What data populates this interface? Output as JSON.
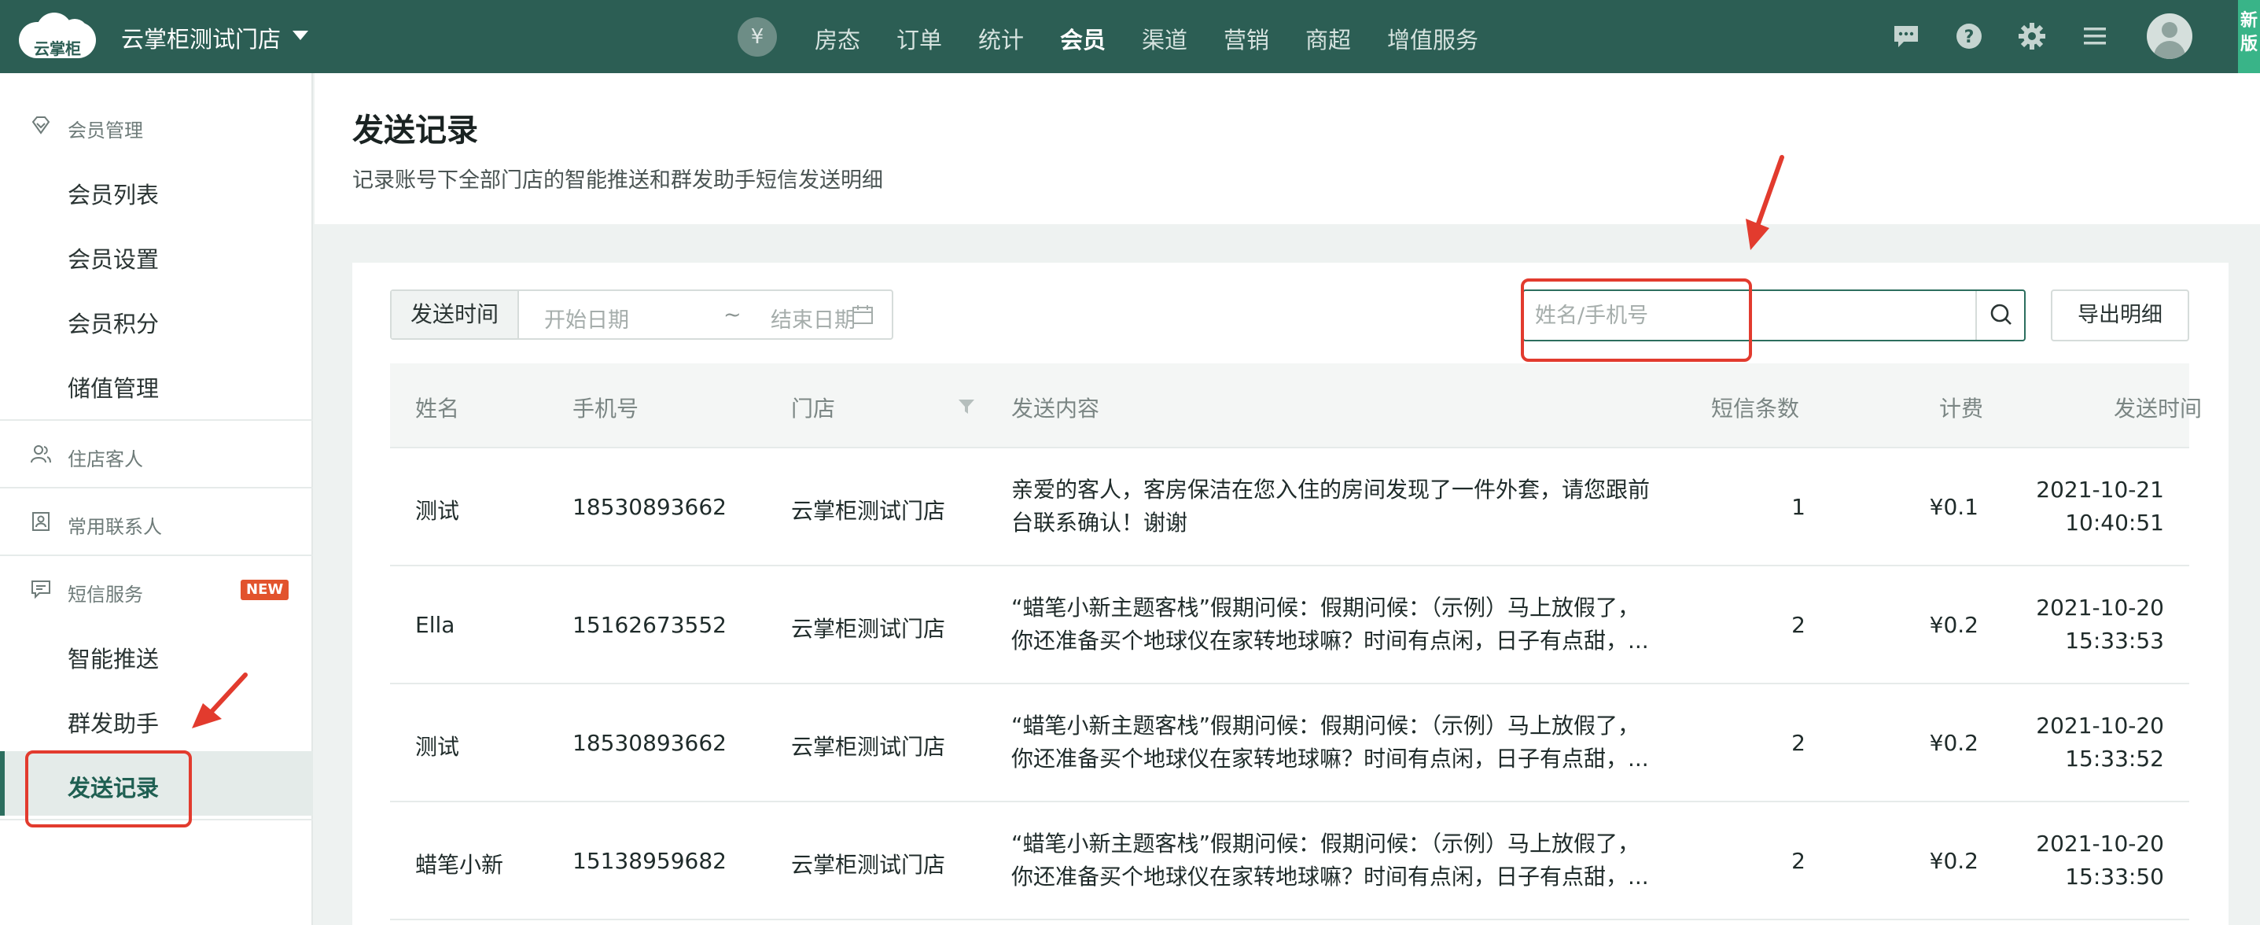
{
  "topbar": {
    "logo_text": "云掌柜",
    "store_name": "云掌柜测试门店",
    "yen_symbol": "¥",
    "nav": [
      "房态",
      "订单",
      "统计",
      "会员",
      "渠道",
      "营销",
      "商超",
      "增值服务"
    ],
    "active_nav": "会员",
    "new_edition_text": "新版"
  },
  "sidebar": {
    "groups": [
      {
        "label": "会员管理",
        "items": [
          "会员列表",
          "会员设置",
          "会员积分",
          "储值管理"
        ]
      },
      {
        "label": "住店客人",
        "items": []
      },
      {
        "label": "常用联系人",
        "items": []
      },
      {
        "label": "短信服务",
        "badge": "NEW",
        "items": [
          "智能推送",
          "群发助手",
          "发送记录"
        ]
      }
    ],
    "active_item": "发送记录"
  },
  "page": {
    "title": "发送记录",
    "subtitle": "记录账号下全部门店的智能推送和群发助手短信发送明细"
  },
  "filters": {
    "date_label": "发送时间",
    "start_placeholder": "开始日期",
    "separator": "~",
    "end_placeholder": "结束日期",
    "search_placeholder": "姓名/手机号",
    "export_label": "导出明细"
  },
  "table": {
    "columns": [
      "姓名",
      "手机号",
      "门店",
      "发送内容",
      "短信条数",
      "计费",
      "发送时间"
    ],
    "rows": [
      {
        "name": "测试",
        "phone": "18530893662",
        "store": "云掌柜测试门店",
        "content1": "亲爱的客人，客房保洁在您入住的房间发现了一件外套，请您跟前",
        "content2": "台联系确认！谢谢",
        "count": "1",
        "fee": "¥0.1",
        "date": "2021-10-21",
        "time": "10:40:51"
      },
      {
        "name": "Ella",
        "phone": "15162673552",
        "store": "云掌柜测试门店",
        "content1": "“蜡笔小新主题客栈”假期问候：假期问候：（示例）马上放假了，",
        "content2": "你还准备买个地球仪在家转地球嘛？时间有点闲，日子有点甜，...",
        "count": "2",
        "fee": "¥0.2",
        "date": "2021-10-20",
        "time": "15:33:53"
      },
      {
        "name": "测试",
        "phone": "18530893662",
        "store": "云掌柜测试门店",
        "content1": "“蜡笔小新主题客栈”假期问候：假期问候：（示例）马上放假了，",
        "content2": "你还准备买个地球仪在家转地球嘛？时间有点闲，日子有点甜，...",
        "count": "2",
        "fee": "¥0.2",
        "date": "2021-10-20",
        "time": "15:33:52"
      },
      {
        "name": "蜡笔小新",
        "phone": "15138959682",
        "store": "云掌柜测试门店",
        "content1": "“蜡笔小新主题客栈”假期问候：假期问候：（示例）马上放假了，",
        "content2": "你还准备买个地球仪在家转地球嘛？时间有点闲，日子有点甜，...",
        "count": "2",
        "fee": "¥0.2",
        "date": "2021-10-20",
        "time": "15:33:50"
      }
    ]
  },
  "colors": {
    "topbar": "#2c5e54",
    "accent": "#2c6e5e",
    "annotation": "#e23b2e",
    "new_badge": "#e2532d"
  }
}
